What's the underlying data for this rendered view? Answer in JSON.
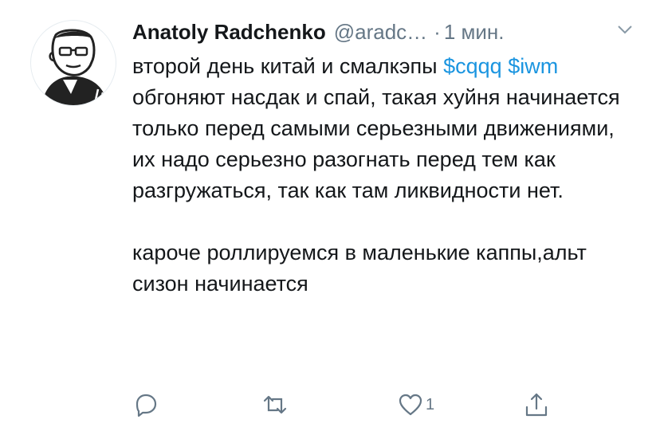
{
  "tweet": {
    "author_name": "Anatoly Radchenko",
    "handle": "@aradc…",
    "separator": "·",
    "time": "1 мин.",
    "paragraph1": {
      "part1": "второй день китай и смалкэпы ",
      "cashtag1": "$cqqq",
      "part2": " ",
      "cashtag2": "$iwm",
      "part3": " обгоняют насдак и спай, такая хуйня начинается только перед самыми серьезными движениями, их надо серьезно разогнать перед тем как разгружаться, так как там ликвидности нет."
    },
    "paragraph2": "кароче роллируемся в маленькие каппы,альт сизон начинается"
  },
  "actions": {
    "reply_icon": "reply-icon",
    "retweet_icon": "retweet-icon",
    "like_icon": "heart-icon",
    "like_count": "1",
    "share_icon": "share-icon"
  },
  "colors": {
    "text": "#14171a",
    "secondary": "#657786",
    "link": "#1b95e0"
  }
}
